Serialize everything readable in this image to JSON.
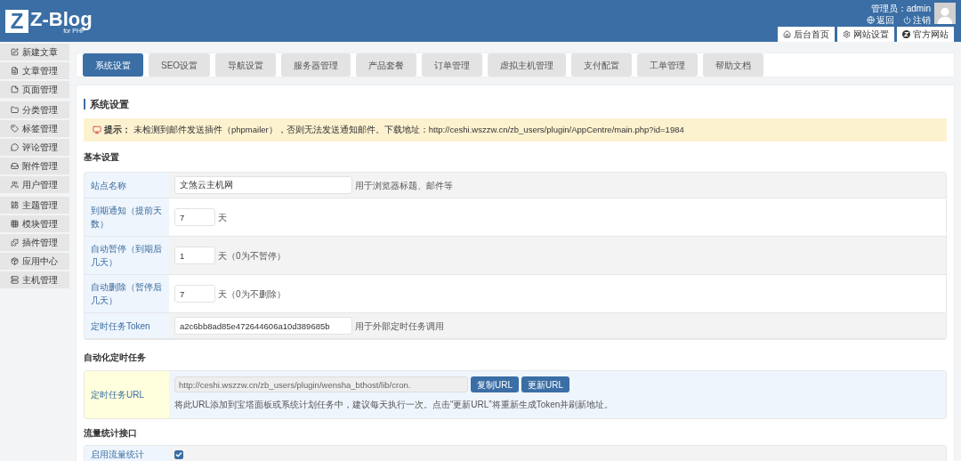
{
  "header": {
    "logo": {
      "mark": "Z",
      "text": "Z-Blog",
      "sub": "for PHP"
    },
    "user_label": "管理员：admin",
    "links": [
      {
        "label": "返回"
      },
      {
        "label": "注销"
      }
    ],
    "tabs": [
      {
        "label": "后台首页"
      },
      {
        "label": "网站设置"
      },
      {
        "label": "官方网站"
      }
    ]
  },
  "sidebar": {
    "groups": [
      [
        {
          "label": "新建文章"
        },
        {
          "label": "文章管理"
        },
        {
          "label": "页面管理"
        }
      ],
      [
        {
          "label": "分类管理"
        },
        {
          "label": "标签管理"
        },
        {
          "label": "评论管理"
        },
        {
          "label": "附件管理"
        },
        {
          "label": "用户管理"
        }
      ],
      [
        {
          "label": "主题管理"
        },
        {
          "label": "模块管理"
        },
        {
          "label": "插件管理"
        },
        {
          "label": "应用中心"
        },
        {
          "label": "主机管理"
        }
      ]
    ]
  },
  "tabs": [
    {
      "label": "系统设置",
      "selected": true
    },
    {
      "label": "SEO设置",
      "selected": false
    },
    {
      "label": "导航设置",
      "selected": false
    },
    {
      "label": "服务器管理",
      "selected": false
    },
    {
      "label": "产品套餐",
      "selected": false
    },
    {
      "label": "订单管理",
      "selected": false
    },
    {
      "label": "虚拟主机管理",
      "selected": false
    },
    {
      "label": "支付配置",
      "selected": false
    },
    {
      "label": "工单管理",
      "selected": false
    },
    {
      "label": "帮助文档",
      "selected": false
    }
  ],
  "page_title": "系统设置",
  "notice": {
    "label": "提示：",
    "text": "未检测到邮件发送插件（phpmailer），否则无法发送通知邮件。下载地址：http://ceshi.wszzw.cn/zb_users/plugin/AppCentre/main.php?id=1984"
  },
  "basic": {
    "title": "基本设置",
    "rows": [
      {
        "kind": "wide",
        "label": "站点名称",
        "value": "文煞云主机网",
        "hint": "用于浏览器标题、邮件等"
      },
      {
        "kind": "short",
        "label": "到期通知（提前天数）",
        "value": "7",
        "hint": "天"
      },
      {
        "kind": "short",
        "label": "自动暂停（到期后几天）",
        "value": "1",
        "hint": "天（0为不暂停）"
      },
      {
        "kind": "short",
        "label": "自动删除（暂停后几天）",
        "value": "7",
        "hint": "天（0为不删除）"
      },
      {
        "kind": "wide",
        "label": "定时任务Token",
        "value": "a2c6bb8ad85e472644606a10d389685b",
        "hint": "用于外部定时任务调用"
      }
    ]
  },
  "cron": {
    "title": "自动化定时任务",
    "label": "定时任务URL",
    "value": "http://ceshi.wszzw.cn/zb_users/plugin/wensha_bthost/lib/cron.",
    "buttons": [
      "复制URL",
      "更新URL"
    ],
    "note": "将此URL添加到宝塔面板或系统计划任务中，建议每天执行一次。点击“更新URL”将重新生成Token并刷新地址。"
  },
  "traffic": {
    "title": "流量统计接口",
    "label": "启用流量统计",
    "checked": true
  }
}
